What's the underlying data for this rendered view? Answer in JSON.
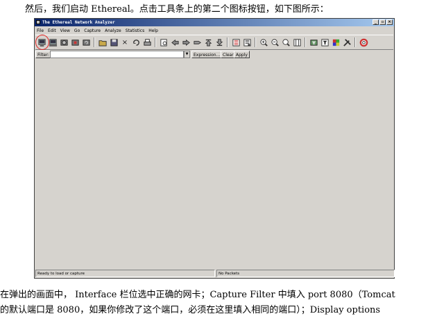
{
  "document": {
    "intro": "然后，我们启动 Ethereal。点击工具条上的第二个图标按钮，如下图所示：",
    "para1": "在弹出的画面中， Interface 栏位选中正确的网卡；Capture Filter 中填入 port 8080（Tomcat",
    "para2": "的默认端口是 8080，如果你修改了这个端口，必须在这里填入相同的端口）；Display options"
  },
  "window": {
    "title": "The Ethereal Network Analyzer",
    "buttons": {
      "minimize": "_",
      "maximize": "▫",
      "close": "×"
    }
  },
  "menu": [
    "File",
    "Edit",
    "View",
    "Go",
    "Capture",
    "Analyze",
    "Statistics",
    "Help"
  ],
  "toolbar": {
    "icons": [
      "interfaces-icon",
      "capture-options-icon",
      "start-capture-icon",
      "stop-capture-icon",
      "restart-capture-icon",
      "open-icon",
      "save-icon",
      "close-file-icon",
      "reload-icon",
      "print-icon",
      "find-icon",
      "back-icon",
      "forward-icon",
      "goto-icon",
      "first-packet-icon",
      "last-packet-icon",
      "colorize-icon",
      "autoscroll-icon",
      "zoom-in-icon",
      "zoom-out-icon",
      "zoom-normal-icon",
      "resize-columns-icon",
      "capture-filter-icon",
      "display-filter-icon",
      "coloring-rules-icon",
      "preferences-icon",
      "help-icon"
    ]
  },
  "filter": {
    "label": "Filter:",
    "value": "",
    "expression": "Expression...",
    "clear": "Clear",
    "apply": "Apply"
  },
  "status": {
    "left": "Ready to load or capture",
    "right": "No Packets"
  },
  "colors": {
    "title_start": "#0a246a",
    "title_end": "#a6caf0",
    "face": "#d6d3ce",
    "annotation": "#e02020"
  }
}
